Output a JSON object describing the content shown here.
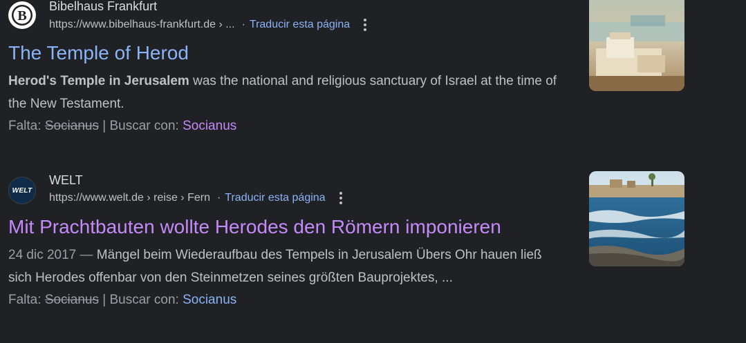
{
  "results": [
    {
      "site_name": "Bibelhaus Frankfurt",
      "url": "https://www.bibelhaus-frankfurt.de › ...",
      "translate": "Traducir esta página",
      "title": "The Temple of Herod",
      "snippet_bold": "Herod's Temple in Jerusalem",
      "snippet_rest": " was the national and religious sanctuary of Israel at the time of the New Testament.",
      "missing_label": "Falta:",
      "missing_term": "Socianus",
      "search_with_label": "| Buscar con:",
      "search_with_term": "Socianus",
      "favicon_icon": "bible-b-icon"
    },
    {
      "site_name": "WELT",
      "url": "https://www.welt.de › reise › Fern",
      "translate": "Traducir esta página",
      "title": "Mit Prachtbauten wollte Herodes den Römern imponieren",
      "date": "24 dic 2017 —",
      "snippet": " Mängel beim Wiederaufbau des Tempels in Jerusalem Übers Ohr hauen ließ sich Herodes offenbar von den Steinmetzen seines größten Bauprojektes, ...",
      "missing_label": "Falta:",
      "missing_term": "Socianus",
      "search_with_label": "| Buscar con:",
      "search_with_term": "Socianus",
      "favicon_text": "WELT"
    }
  ],
  "colors": {
    "background": "#202124",
    "link_unvisited": "#8ab4f8",
    "link_visited": "#c58af9",
    "text": "#bdc1c6"
  }
}
